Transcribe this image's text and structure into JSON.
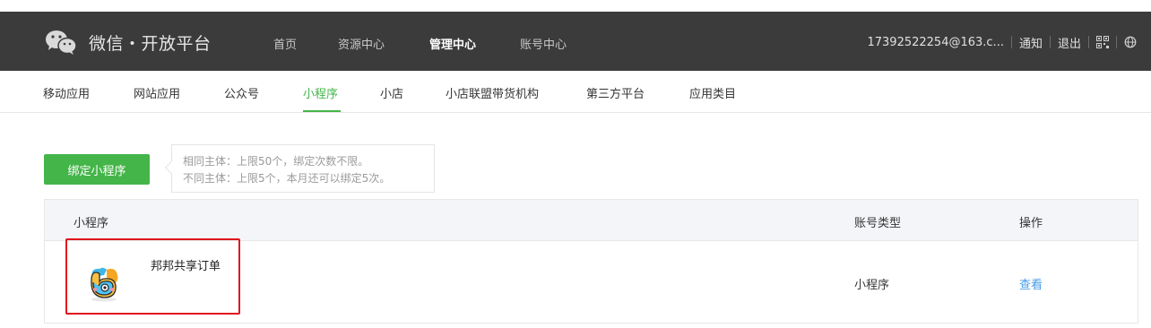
{
  "header": {
    "brand": "微信・开放平台",
    "nav": [
      "首页",
      "资源中心",
      "管理中心",
      "账号中心"
    ],
    "active_nav": "管理中心",
    "account": "17392522254@163.c...",
    "notify_label": "通知",
    "logout_label": "退出",
    "icons": [
      "wechat-logo",
      "qrcode-icon",
      "globe-icon"
    ]
  },
  "subnav": {
    "items": [
      "移动应用",
      "网站应用",
      "公众号",
      "小程序",
      "小店",
      "小店联盟带货机构",
      "第三方平台",
      "应用类目"
    ],
    "active": "小程序"
  },
  "actions": {
    "bind_label": "绑定小程序",
    "tip_lines": [
      "相同主体：上限50个，绑定次数不限。",
      "不同主体：上限5个，本月还可以绑定5次。"
    ]
  },
  "table": {
    "columns": [
      "小程序",
      "账号类型",
      "操作"
    ],
    "rows": [
      {
        "name": "邦邦共享订单",
        "type": "小程序",
        "action": "查看"
      }
    ]
  },
  "colors": {
    "topbar": "#3b3b3b",
    "accent": "#44b549",
    "link": "#459ae9",
    "highlight": "#e0151d"
  }
}
